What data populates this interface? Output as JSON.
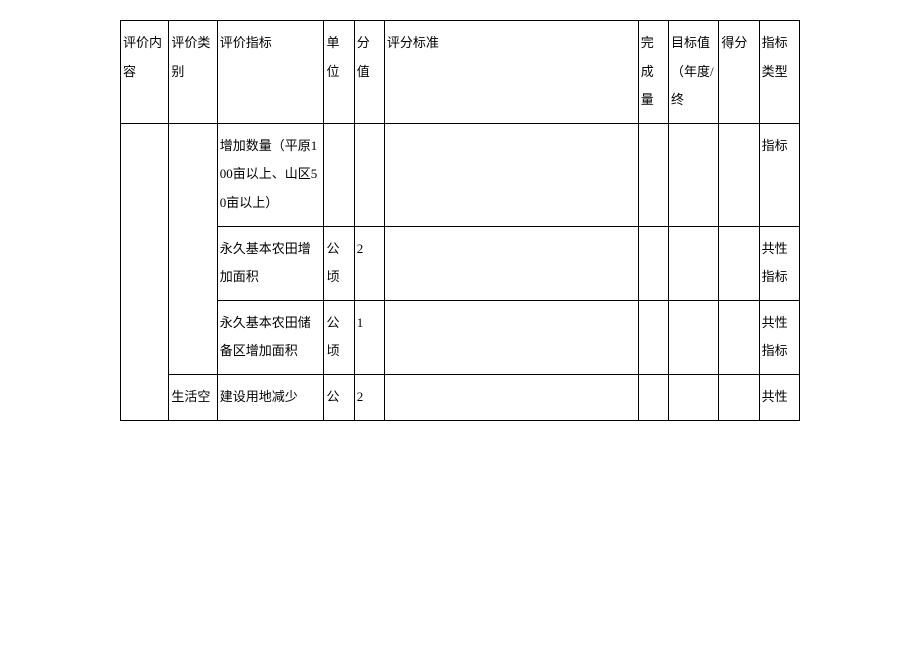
{
  "headers": {
    "col1": "评价内容",
    "col2": "评价类别",
    "col3": "评价指标",
    "col4": "单位",
    "col5": "分值",
    "col6": "评分标准",
    "col7": "完成量",
    "col8": "目标值（年度/终",
    "col9": "得分",
    "col10": "指标类型"
  },
  "rows": [
    {
      "col1": "",
      "col2": "",
      "col3": "增加数量（平原100亩以上、山区50亩以上）",
      "col4": "",
      "col5": "",
      "col6": "",
      "col7": "",
      "col8": "",
      "col9": "",
      "col10": "指标"
    },
    {
      "col1": "",
      "col2": "",
      "col3": "永久基本农田增加面积",
      "col4": "公顷",
      "col5": "2",
      "col6": "",
      "col7": "",
      "col8": "",
      "col9": "",
      "col10": "共性指标"
    },
    {
      "col1": "",
      "col2": "",
      "col3": "永久基本农田储备区增加面积",
      "col4": "公顷",
      "col5": "1",
      "col6": "",
      "col7": "",
      "col8": "",
      "col9": "",
      "col10": "共性指标"
    },
    {
      "col1": "",
      "col2": "生活空",
      "col3": "建设用地减少",
      "col4": "公",
      "col5": "2",
      "col6": "",
      "col7": "",
      "col8": "",
      "col9": "",
      "col10": "共性"
    }
  ]
}
